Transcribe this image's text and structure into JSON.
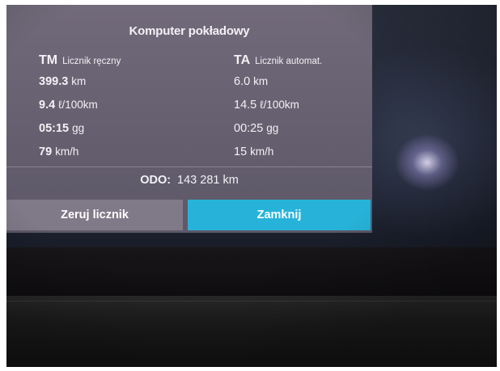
{
  "dialog": {
    "title": "Komputer pokładowy",
    "left": {
      "code": "TM",
      "label": "Licznik ręczny",
      "rows": [
        {
          "value": "399.3",
          "unit": "km"
        },
        {
          "value": "9.4",
          "unit": "ℓ/100km"
        },
        {
          "value": "05:15",
          "unit": "gg"
        },
        {
          "value": "79",
          "unit": "km/h"
        }
      ]
    },
    "right": {
      "code": "TA",
      "label": "Licznik automat.",
      "rows": [
        {
          "value": "6.0",
          "unit": "km"
        },
        {
          "value": "14.5",
          "unit": "ℓ/100km"
        },
        {
          "value": "00:25",
          "unit": "gg"
        },
        {
          "value": "15",
          "unit": "km/h"
        }
      ]
    },
    "odometer": {
      "label": "ODO:",
      "value": "143 281",
      "unit": "km"
    },
    "buttons": {
      "reset_label": "Zeruj licznik",
      "close_label": "Zamknij"
    }
  },
  "colors": {
    "dialog_bg": "#6b6574",
    "reset_button": "#807a88",
    "close_button": "#27b3d9",
    "text": "#f3f1f6"
  }
}
